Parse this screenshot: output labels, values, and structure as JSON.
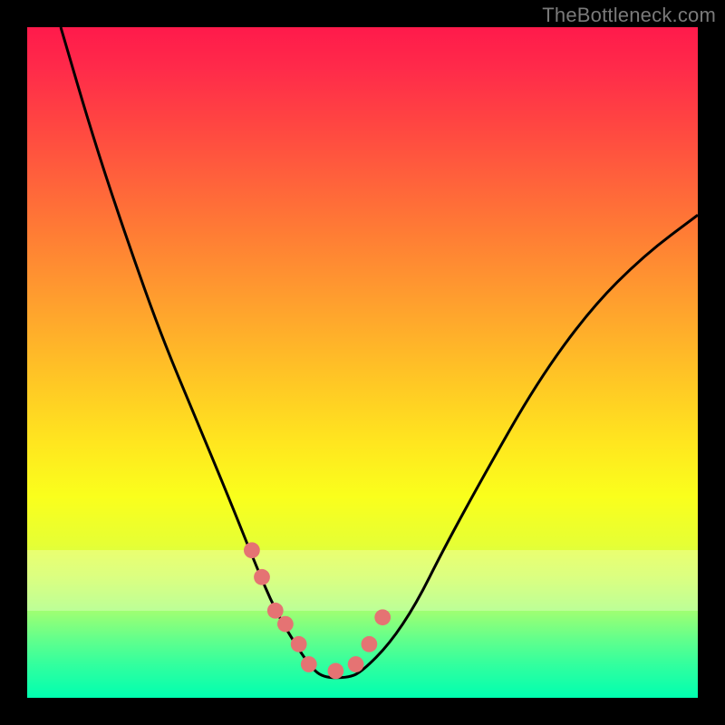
{
  "watermark": "TheBottleneck.com",
  "chart_data": {
    "type": "line",
    "title": "",
    "xlabel": "",
    "ylabel": "",
    "xlim": [
      0,
      100
    ],
    "ylim": [
      0,
      100
    ],
    "legend": false,
    "grid": false,
    "annotations": [],
    "background_gradient": {
      "direction": "top-to-bottom",
      "stops": [
        {
          "pos": 0,
          "color": "#ff1a4b"
        },
        {
          "pos": 50,
          "color": "#ffcb24"
        },
        {
          "pos": 80,
          "color": "#e6ff34"
        },
        {
          "pos": 100,
          "color": "#00ffb0"
        }
      ]
    },
    "series": [
      {
        "name": "black-curve",
        "x": [
          5,
          10,
          15,
          20,
          25,
          30,
          34,
          37,
          40,
          42,
          44,
          48,
          50,
          54,
          58,
          62,
          68,
          76,
          84,
          92,
          100
        ],
        "values": [
          100,
          83,
          68,
          54,
          42,
          30,
          20,
          13,
          8,
          5,
          3,
          3,
          4,
          8,
          14,
          22,
          33,
          47,
          58,
          66,
          72
        ],
        "color": "#000000",
        "stroke_width": 3
      },
      {
        "name": "pink-markers",
        "x": [
          33.5,
          35,
          37,
          38.5,
          40.5,
          42,
          46,
          49,
          51,
          53
        ],
        "values": [
          22,
          18,
          13,
          11,
          8,
          5,
          4,
          5,
          8,
          12
        ],
        "color": "#e57373",
        "marker_radius": 6
      }
    ]
  }
}
